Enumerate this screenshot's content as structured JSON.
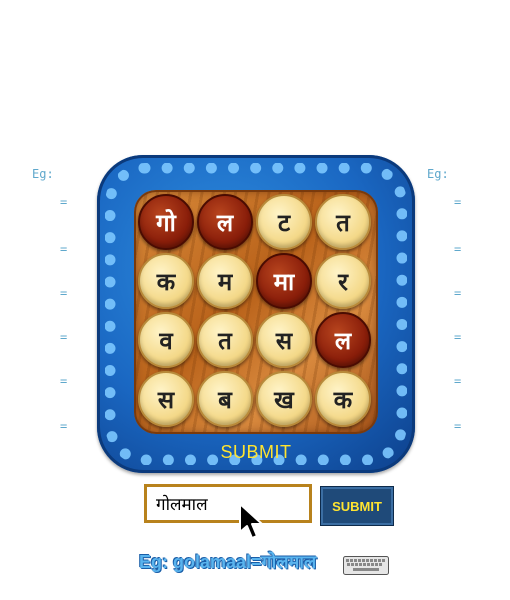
{
  "left_panel": {
    "example_label": "Eg:",
    "rows": [
      "=",
      "=",
      "=",
      "=",
      "=",
      "="
    ]
  },
  "right_panel": {
    "example_label": "Eg:",
    "rows": [
      "=",
      "=",
      "=",
      "=",
      "=",
      "="
    ]
  },
  "board": {
    "tiles": [
      {
        "text": "गो",
        "selected": true
      },
      {
        "text": "ल",
        "selected": true
      },
      {
        "text": "ट",
        "selected": false
      },
      {
        "text": "त",
        "selected": false
      },
      {
        "text": "क",
        "selected": false
      },
      {
        "text": "म",
        "selected": false
      },
      {
        "text": "मा",
        "selected": true
      },
      {
        "text": "र",
        "selected": false
      },
      {
        "text": "व",
        "selected": false
      },
      {
        "text": "त",
        "selected": false
      },
      {
        "text": "स",
        "selected": false
      },
      {
        "text": "ल",
        "selected": true
      },
      {
        "text": "स",
        "selected": false
      },
      {
        "text": "ब",
        "selected": false
      },
      {
        "text": "ख",
        "selected": false
      },
      {
        "text": "क",
        "selected": false
      }
    ],
    "submit_label": "SUBMIT"
  },
  "answer": {
    "value": "गोलमाल"
  },
  "submit_button": {
    "label": "SUBMIT"
  },
  "example": {
    "text": "Eg: golamaal=गोलमाल"
  },
  "icons": {
    "cursor": "mouse-pointer-icon",
    "keyboard": "keyboard-icon"
  }
}
